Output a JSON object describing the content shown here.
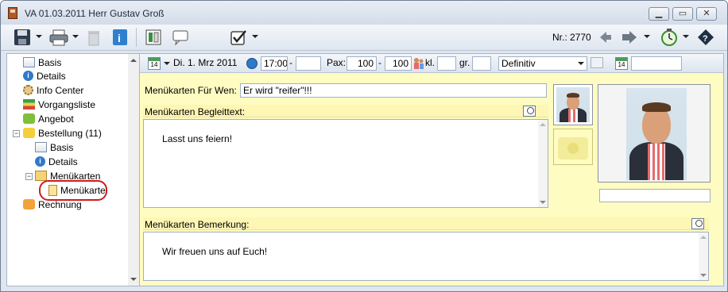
{
  "window": {
    "title": "VA 01.03.2011 Herr Gustav Groß"
  },
  "toolbar": {
    "nr_label": "Nr.: 2770"
  },
  "sidebar": {
    "items": [
      {
        "label": "Basis"
      },
      {
        "label": "Details"
      },
      {
        "label": "Info Center"
      },
      {
        "label": "Vorgangsliste"
      },
      {
        "label": "Angebot"
      },
      {
        "label": "Bestellung (11)"
      },
      {
        "label": "Basis"
      },
      {
        "label": "Details"
      },
      {
        "label": "Menükarten"
      },
      {
        "label": "Menükarte"
      },
      {
        "label": "Rechnung"
      }
    ]
  },
  "filter": {
    "calendar_day": "14",
    "date": "Di. 1. Mrz 2011",
    "time_from": "17:00",
    "time_sep": "-",
    "time_to": "",
    "pax_label": "Pax:",
    "pax_from": "100",
    "pax_sep": "-",
    "pax_to": "100",
    "kl_label": "kl.",
    "kl_value": "",
    "gr_label": "gr.",
    "gr_value": "",
    "status": "Definitiv",
    "calendar2_day": "14",
    "date2": ""
  },
  "form": {
    "fuer_wen_label": "Menükarten Für Wen:",
    "fuer_wen_value": "Er wird \"reifer\"!!!",
    "begleittext_label": "Menükarten Begleittext:",
    "begleittext_value": "Lasst uns feiern!",
    "bemerkung_label": "Menükarten Bemerkung:",
    "bemerkung_value": "Wir freuen uns auf Euch!",
    "photo_caption": ""
  }
}
